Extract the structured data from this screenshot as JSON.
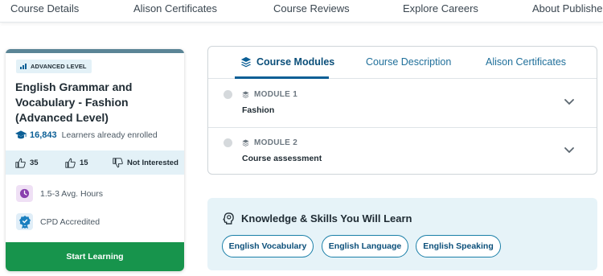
{
  "nav": {
    "items": [
      "Course Details",
      "Alison Certificates",
      "Course Reviews",
      "Explore Careers",
      "About Publisher"
    ]
  },
  "course": {
    "level": "ADVANCED LEVEL",
    "title": "English Grammar and Vocabulary - Fashion (Advanced Level)",
    "learners_count": "16,843",
    "learners_label": "Learners already enrolled",
    "likes": "35",
    "thumbs": "15",
    "not_interested": "Not Interested",
    "hours": "1.5-3 Avg. Hours",
    "accreditation": "CPD Accredited",
    "start_button": "Start Learning",
    "colors": {
      "accent": "#0b5f96",
      "start": "#17944c",
      "clock_bg": "#efe0f5",
      "cpd_bg": "#e0eef8"
    }
  },
  "modules_panel": {
    "tabs": [
      "Course Modules",
      "Course Description",
      "Alison Certificates"
    ],
    "active_tab": "Course Modules",
    "modules": [
      {
        "label": "MODULE 1",
        "name": "Fashion"
      },
      {
        "label": "MODULE 2",
        "name": "Course assessment"
      }
    ]
  },
  "skills": {
    "heading": "Knowledge & Skills You Will Learn",
    "chips": [
      "English Vocabulary",
      "English Language",
      "English Speaking"
    ]
  }
}
